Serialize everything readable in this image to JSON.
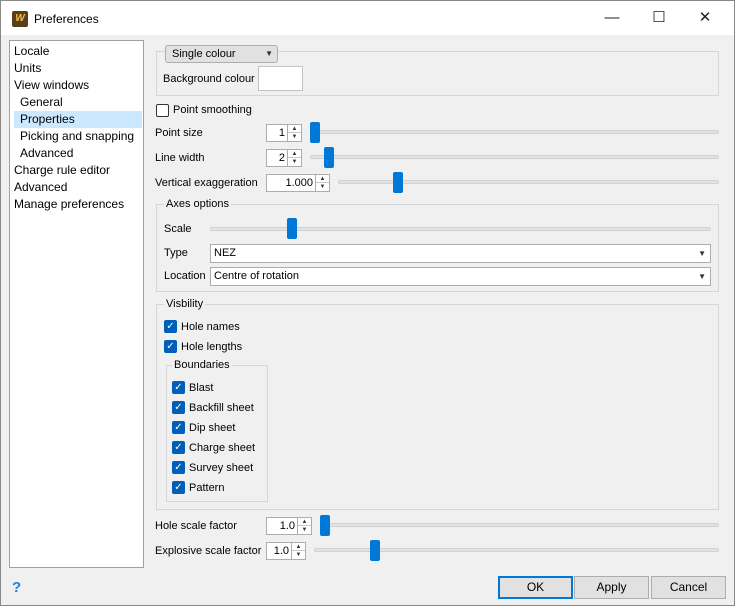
{
  "window": {
    "title": "Preferences",
    "minimize": "—",
    "maximize": "☐",
    "close": "✕",
    "icon_glyph": "W"
  },
  "sidebar": {
    "items": [
      {
        "label": "Locale"
      },
      {
        "label": "Units"
      },
      {
        "label": "View windows"
      },
      {
        "label": "General"
      },
      {
        "label": "Properties"
      },
      {
        "label": "Picking and snapping"
      },
      {
        "label": "Advanced"
      },
      {
        "label": "Charge rule editor"
      },
      {
        "label": "Advanced"
      },
      {
        "label": "Manage preferences"
      }
    ],
    "selected": "Properties"
  },
  "background": {
    "mode": "Single colour",
    "colour_label": "Background colour",
    "colour": "#ffffff"
  },
  "point_smoothing": {
    "label": "Point smoothing",
    "checked": false
  },
  "point_size": {
    "label": "Point size",
    "value": "1",
    "slider_fraction": 0.0
  },
  "line_width": {
    "label": "Line width",
    "value": "2",
    "slider_fraction": 0.04
  },
  "vertical_exaggeration": {
    "label": "Vertical exaggeration",
    "value": "1.000",
    "slider_fraction": 0.15
  },
  "axes": {
    "legend": "Axes options",
    "scale_label": "Scale",
    "scale_fraction": 0.16,
    "type_label": "Type",
    "type_value": "NEZ",
    "location_label": "Location",
    "location_value": "Centre of rotation"
  },
  "visibility": {
    "legend": "Visbility",
    "hole_names": {
      "label": "Hole names",
      "checked": true
    },
    "hole_lengths": {
      "label": "Hole lengths",
      "checked": true
    },
    "boundaries": {
      "legend": "Boundaries",
      "items": [
        {
          "label": "Blast",
          "checked": true
        },
        {
          "label": "Backfill sheet",
          "checked": true
        },
        {
          "label": "Dip sheet",
          "checked": true
        },
        {
          "label": "Charge sheet",
          "checked": true
        },
        {
          "label": "Survey sheet",
          "checked": true
        },
        {
          "label": "Pattern",
          "checked": true
        }
      ]
    }
  },
  "hole_scale_factor": {
    "label": "Hole scale factor",
    "value": "1.0",
    "slider_fraction": 0.0
  },
  "explosive_scale_factor": {
    "label": "Explosive scale factor",
    "value": "1.0",
    "slider_fraction": 0.15
  },
  "buttons": {
    "ok": "OK",
    "apply": "Apply",
    "cancel": "Cancel",
    "help": "?"
  },
  "colors": {
    "accent": "#0078d7",
    "selection": "#cce8ff",
    "check": "#005fb8"
  }
}
